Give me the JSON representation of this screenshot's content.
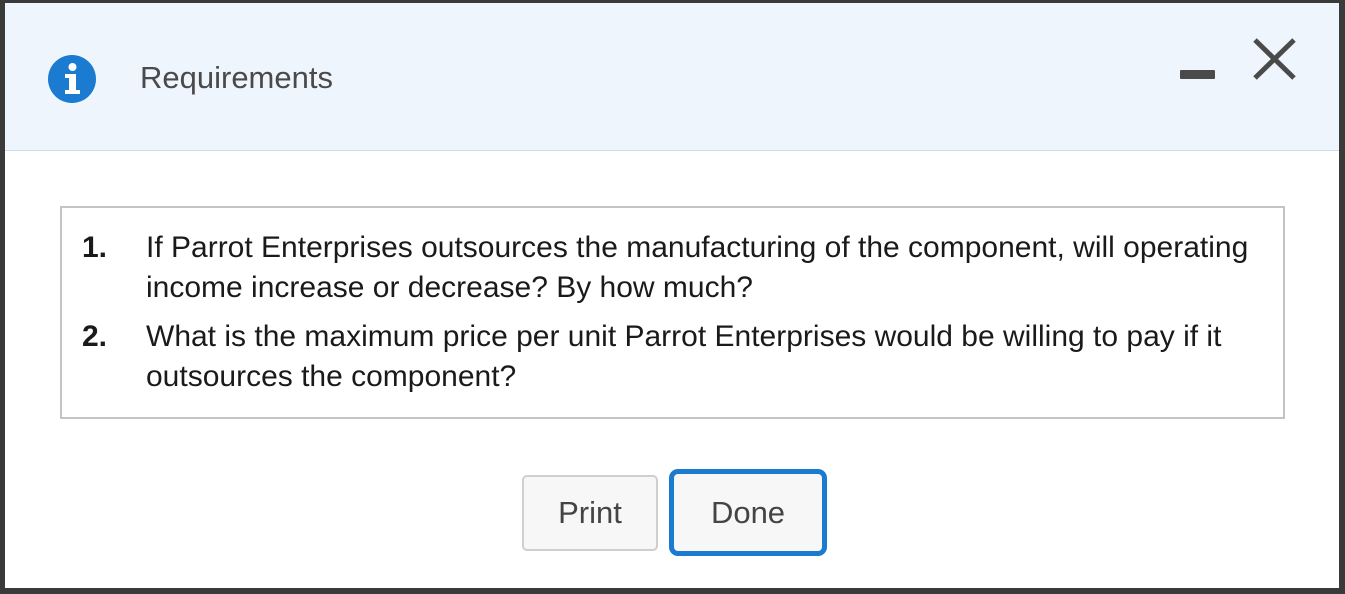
{
  "dialog": {
    "title": "Requirements",
    "icons": {
      "info": "info-icon",
      "minimize": "minimize-icon",
      "close": "close-icon"
    },
    "requirements": [
      {
        "number": "1.",
        "text": "If Parrot Enterprises outsources the manufacturing of the component, will operating income increase or decrease? By how much?"
      },
      {
        "number": "2.",
        "text": "What is the maximum price per unit Parrot Enterprises would be willing to pay if it outsources the component?"
      }
    ],
    "buttons": {
      "print": "Print",
      "done": "Done"
    }
  },
  "colors": {
    "header_bg": "#eef5fd",
    "accent": "#1a7bd0",
    "icon_blue": "#1a7bd0",
    "text": "#1a1a1a"
  }
}
